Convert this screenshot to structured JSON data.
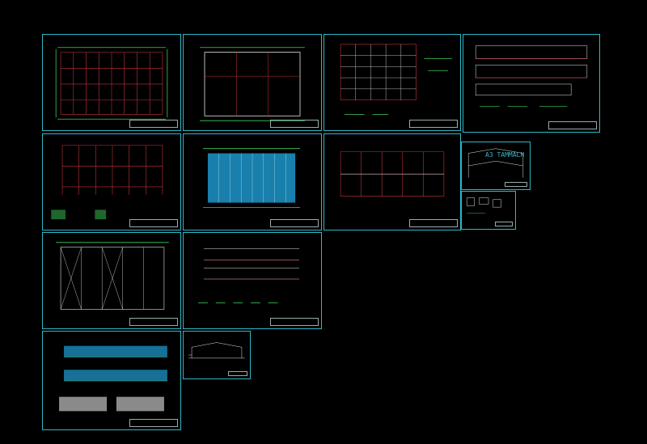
{
  "viewport": {
    "background": "#000000"
  },
  "colors": {
    "frame": "#2fb8c8",
    "grid_red": "#c8323c",
    "grid_green": "#3ccf5a",
    "grid_white": "#e8e8e8",
    "roof_blue": "#1fa0d8",
    "title_block": "#a0b0b0"
  },
  "tag_text": "A3 TAMMALN",
  "sheets": [
    {
      "id": "s1",
      "kind": "plan-red-grid"
    },
    {
      "id": "s2",
      "kind": "plan-white-grid"
    },
    {
      "id": "s3",
      "kind": "plan-dense-grid"
    },
    {
      "id": "s4",
      "kind": "elevations"
    },
    {
      "id": "s5",
      "kind": "plan-red-grid-details"
    },
    {
      "id": "s6",
      "kind": "roof-plan-blue"
    },
    {
      "id": "s7",
      "kind": "plan-red-grid-wide"
    },
    {
      "id": "s8",
      "kind": "frame-elevation"
    },
    {
      "id": "s9",
      "kind": "details"
    },
    {
      "id": "s10",
      "kind": "plan-white-bracing"
    },
    {
      "id": "s11",
      "kind": "truss-sections"
    },
    {
      "id": "s12",
      "kind": "building-elevations"
    },
    {
      "id": "s13",
      "kind": "section"
    }
  ]
}
